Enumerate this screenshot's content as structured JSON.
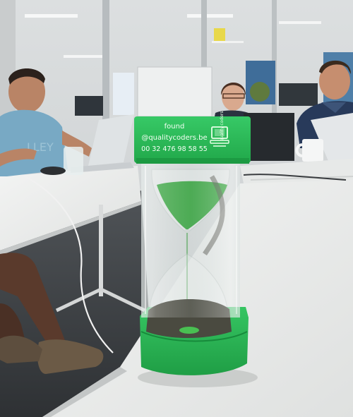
{
  "scene": {
    "description_tags": [
      "office",
      "meeting-room",
      "people",
      "laptops",
      "hourglass"
    ]
  },
  "hourglass_label": {
    "line1": "found",
    "line2": "@qualitycoders.be",
    "line3": "00 32 476 98 58 55",
    "side_text": "quality coders"
  },
  "colors": {
    "plastic_green": "#2fbf5a",
    "sand_green": "#37a43f",
    "table_white": "#eceeed",
    "floor_dark": "#3d4044"
  }
}
